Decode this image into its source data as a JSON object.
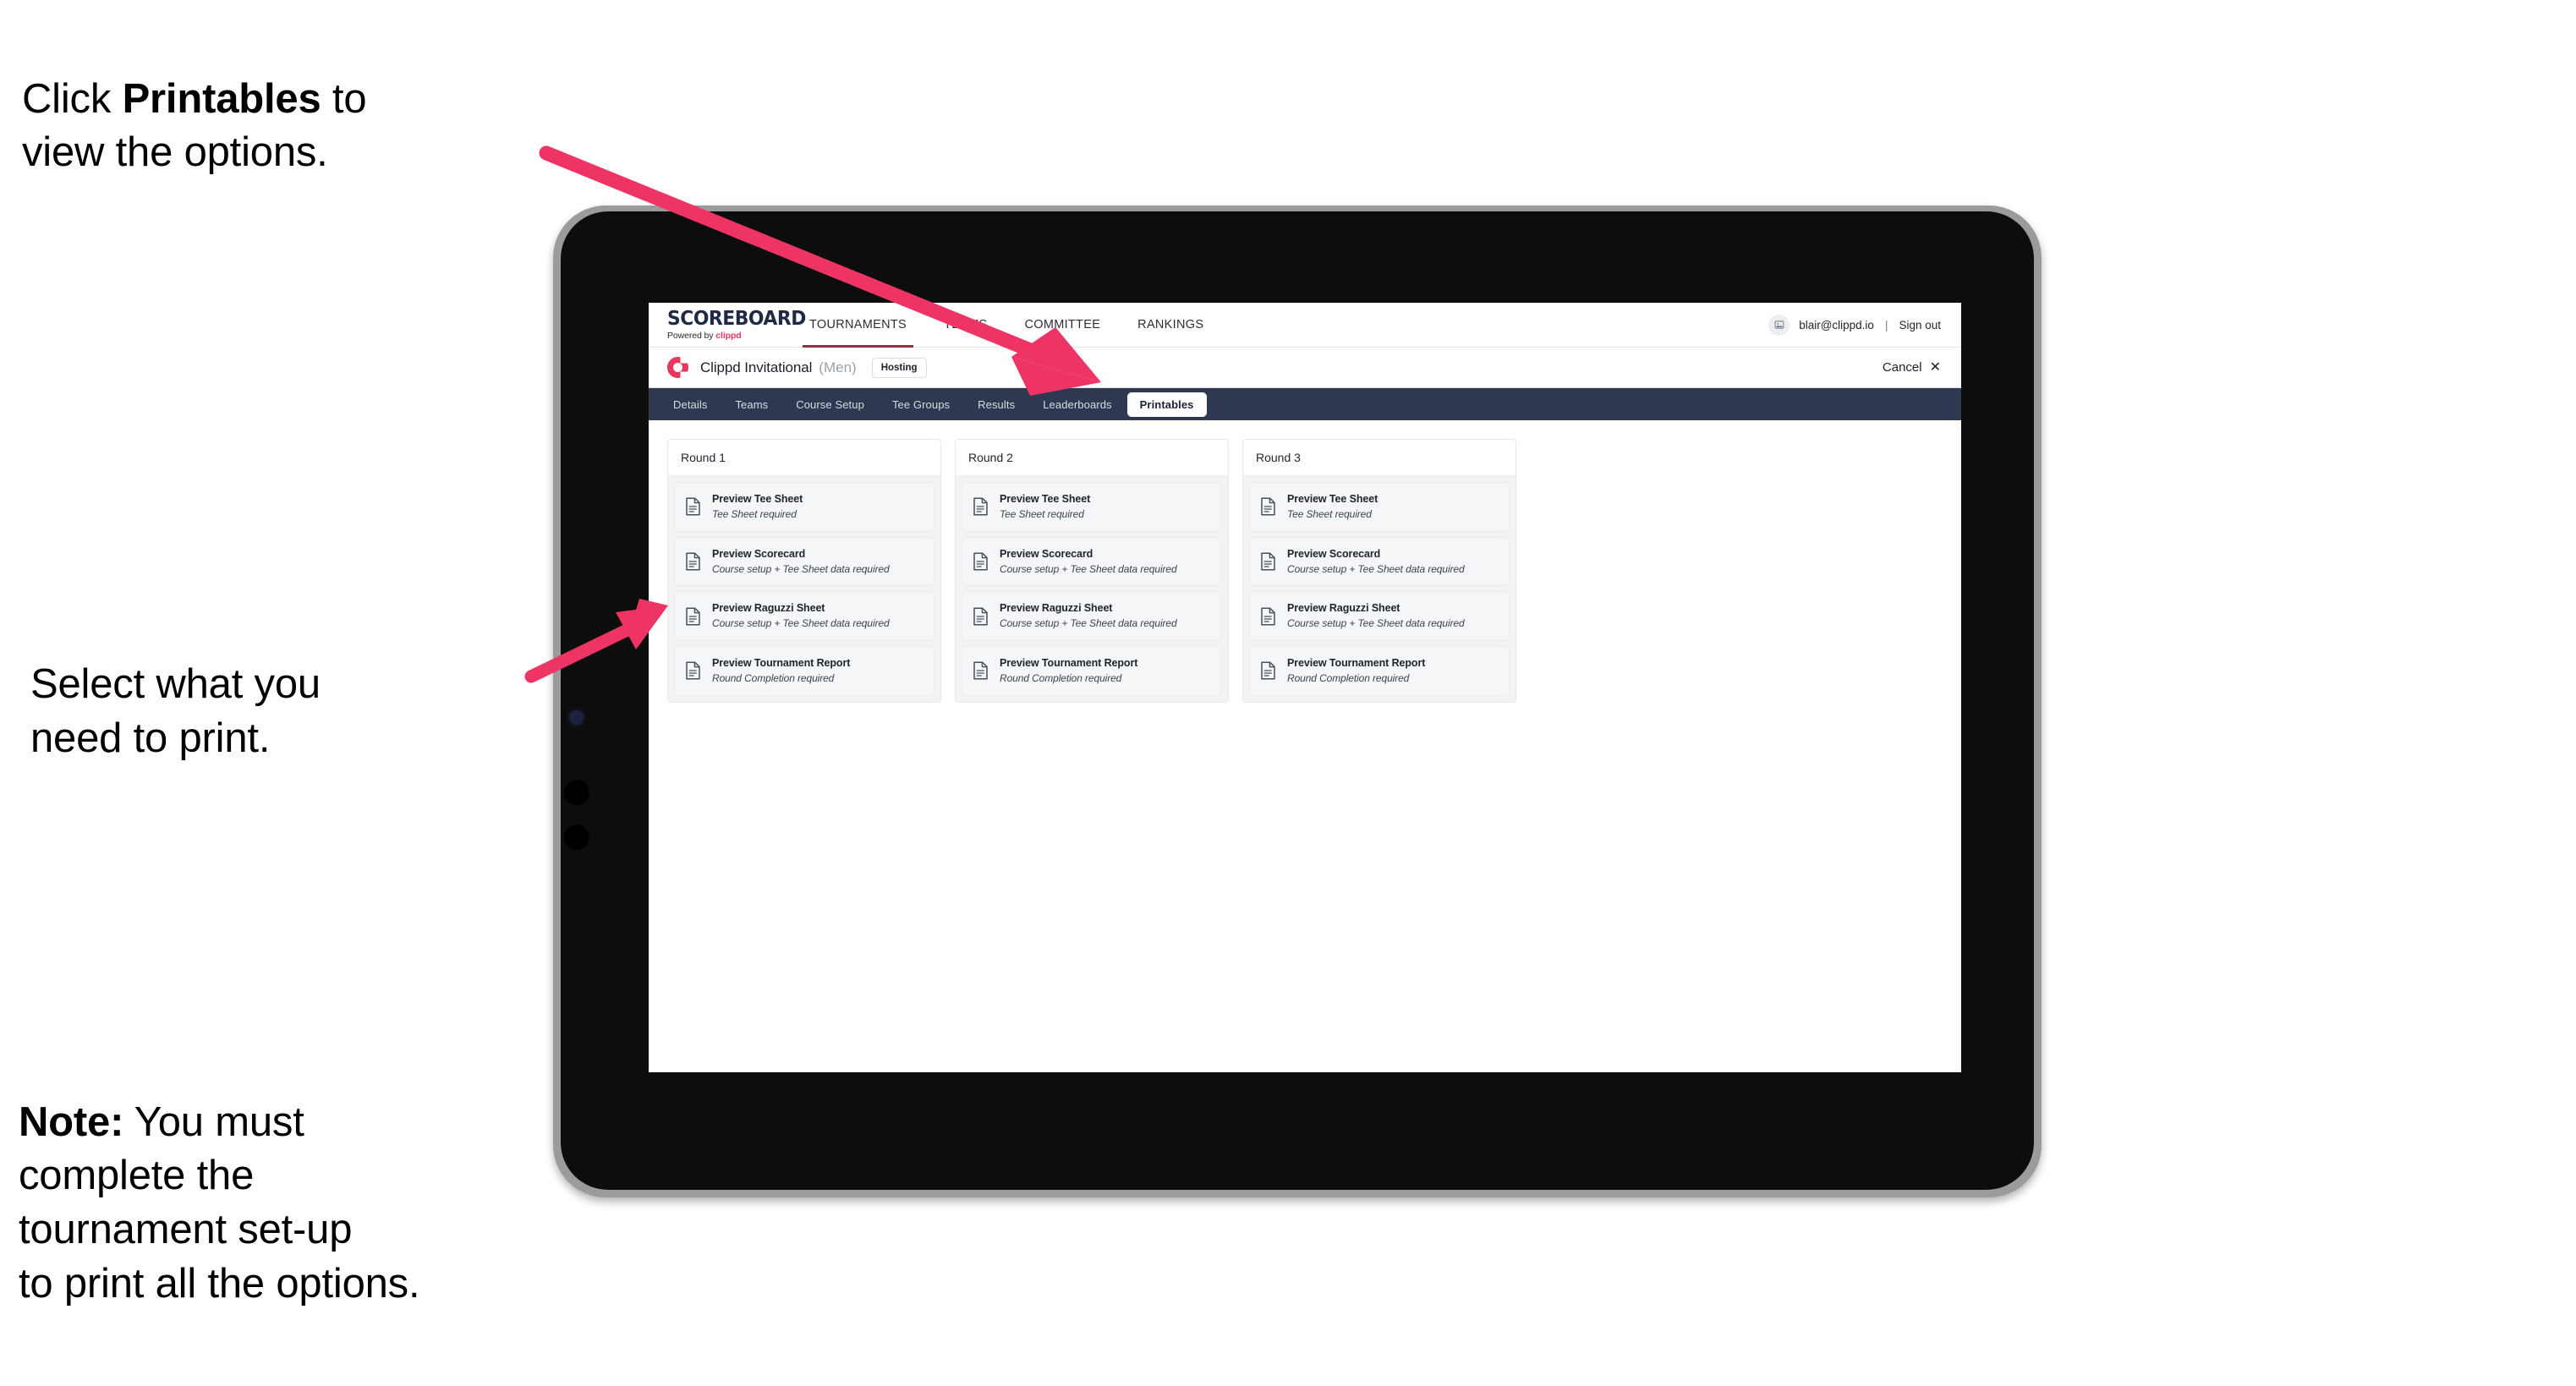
{
  "annotations": {
    "top": {
      "prefix": "Click ",
      "bold": "Printables",
      "suffix": " to\nview the options."
    },
    "middle": {
      "text": "Select what you\n need to print."
    },
    "note": {
      "bold": "Note:",
      "text": " You must\ncomplete the\ntournament set-up\nto print all the options."
    }
  },
  "colors": {
    "accent_pink": "#ee3465",
    "brand_red": "#e8365d",
    "tabstrip_navy": "#2e3951",
    "device_bezel": "#9b9b9b",
    "device_frame": "#0d0d0d"
  },
  "app": {
    "logo": {
      "main": "SCOREBOARD",
      "sub_prefix": "Powered by ",
      "sub_brand": "clippd"
    },
    "top_nav": [
      {
        "label": "TOURNAMENTS",
        "active": true
      },
      {
        "label": "TEAMS",
        "active": false
      },
      {
        "label": "COMMITTEE",
        "active": false
      },
      {
        "label": "RANKINGS",
        "active": false
      }
    ],
    "account": {
      "avatar_icon": "user-avatar-icon",
      "email": "blair@clippd.io",
      "separator": "|",
      "sign_out": "Sign out"
    },
    "tournament_bar": {
      "logo_icon": "clippd-c-logo",
      "title": "Clippd Invitational",
      "gender": "(Men)",
      "badge": "Hosting",
      "cancel_label": "Cancel",
      "cancel_icon": "close-x-icon"
    },
    "tabs": [
      {
        "label": "Details",
        "active": false
      },
      {
        "label": "Teams",
        "active": false
      },
      {
        "label": "Course Setup",
        "active": false
      },
      {
        "label": "Tee Groups",
        "active": false
      },
      {
        "label": "Results",
        "active": false
      },
      {
        "label": "Leaderboards",
        "active": false
      },
      {
        "label": "Printables",
        "active": true
      }
    ],
    "rounds": [
      {
        "header": "Round 1",
        "items": [
          {
            "title": "Preview Tee Sheet",
            "sub": "Tee Sheet required",
            "icon": "document-icon"
          },
          {
            "title": "Preview Scorecard",
            "sub": "Course setup + Tee Sheet data required",
            "icon": "document-icon"
          },
          {
            "title": "Preview Raguzzi Sheet",
            "sub": "Course setup + Tee Sheet data required",
            "icon": "document-icon"
          },
          {
            "title": "Preview Tournament Report",
            "sub": "Round Completion required",
            "icon": "document-icon"
          }
        ]
      },
      {
        "header": "Round 2",
        "items": [
          {
            "title": "Preview Tee Sheet",
            "sub": "Tee Sheet required",
            "icon": "document-icon"
          },
          {
            "title": "Preview Scorecard",
            "sub": "Course setup + Tee Sheet data required",
            "icon": "document-icon"
          },
          {
            "title": "Preview Raguzzi Sheet",
            "sub": "Course setup + Tee Sheet data required",
            "icon": "document-icon"
          },
          {
            "title": "Preview Tournament Report",
            "sub": "Round Completion required",
            "icon": "document-icon"
          }
        ]
      },
      {
        "header": "Round 3",
        "items": [
          {
            "title": "Preview Tee Sheet",
            "sub": "Tee Sheet required",
            "icon": "document-icon"
          },
          {
            "title": "Preview Scorecard",
            "sub": "Course setup + Tee Sheet data required",
            "icon": "document-icon"
          },
          {
            "title": "Preview Raguzzi Sheet",
            "sub": "Course setup + Tee Sheet data required",
            "icon": "document-icon"
          },
          {
            "title": "Preview Tournament Report",
            "sub": "Round Completion required",
            "icon": "document-icon"
          }
        ]
      }
    ]
  }
}
